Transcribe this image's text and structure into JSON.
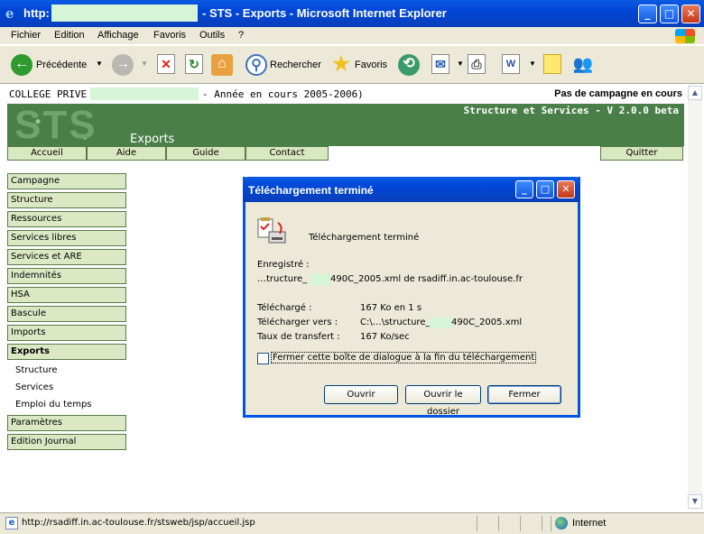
{
  "window": {
    "title_prefix": "http:",
    "title_main": "- STS - Exports - Microsoft Internet Explorer",
    "min": "_",
    "max": "□",
    "close": "✕"
  },
  "menubar": [
    "Fichier",
    "Edition",
    "Affichage",
    "Favoris",
    "Outils",
    "?"
  ],
  "toolbar": {
    "back": "Précédente",
    "search": "Rechercher",
    "favorites": "Favoris"
  },
  "page": {
    "college": "COLLEGE PRIVE",
    "year": "- Année en cours 2005-2006)",
    "campaign": "Pas de campagne en cours",
    "app_title": "Structure et Services - V 2.0.0 beta",
    "logo": "STS",
    "section": "Exports",
    "nav": [
      "Accueil",
      "Aide",
      "Guide",
      "Contact",
      "Quitter"
    ],
    "sidebar": [
      "Campagne",
      "Structure",
      "Ressources",
      "Services libres",
      "Services et ARE",
      "Indemnités",
      "HSA",
      "Bascule",
      "Imports",
      "Exports"
    ],
    "sidebar_sub": [
      "Structure",
      "Services",
      "Emploi du temps"
    ],
    "sidebar_bottom": [
      "Paramètres",
      "Edition Journal"
    ]
  },
  "dialog": {
    "title": "Téléchargement terminé",
    "heading": "Téléchargement terminé",
    "saved_label": "Enregistré :",
    "saved_value_a": "…tructure_",
    "saved_value_b": "490C_2005.xml de rsadiff.in.ac-toulouse.fr",
    "downloaded_label": "Téléchargé :",
    "downloaded_value": "167 Ko en 1 s",
    "dest_label": "Télécharger vers :",
    "dest_value_a": "C:\\…\\structure_",
    "dest_value_b": "490C_2005.xml",
    "rate_label": "Taux de transfert :",
    "rate_value": "167 Ko/sec",
    "checkbox_label": "Fermer cette boîte de dialogue à la fin du téléchargement",
    "btn_open": "Ouvrir",
    "btn_open_folder": "Ouvrir le dossier",
    "btn_close": "Fermer"
  },
  "status": {
    "url": "http://rsadiff.in.ac-toulouse.fr/stsweb/jsp/accueil.jsp",
    "zone": "Internet"
  }
}
